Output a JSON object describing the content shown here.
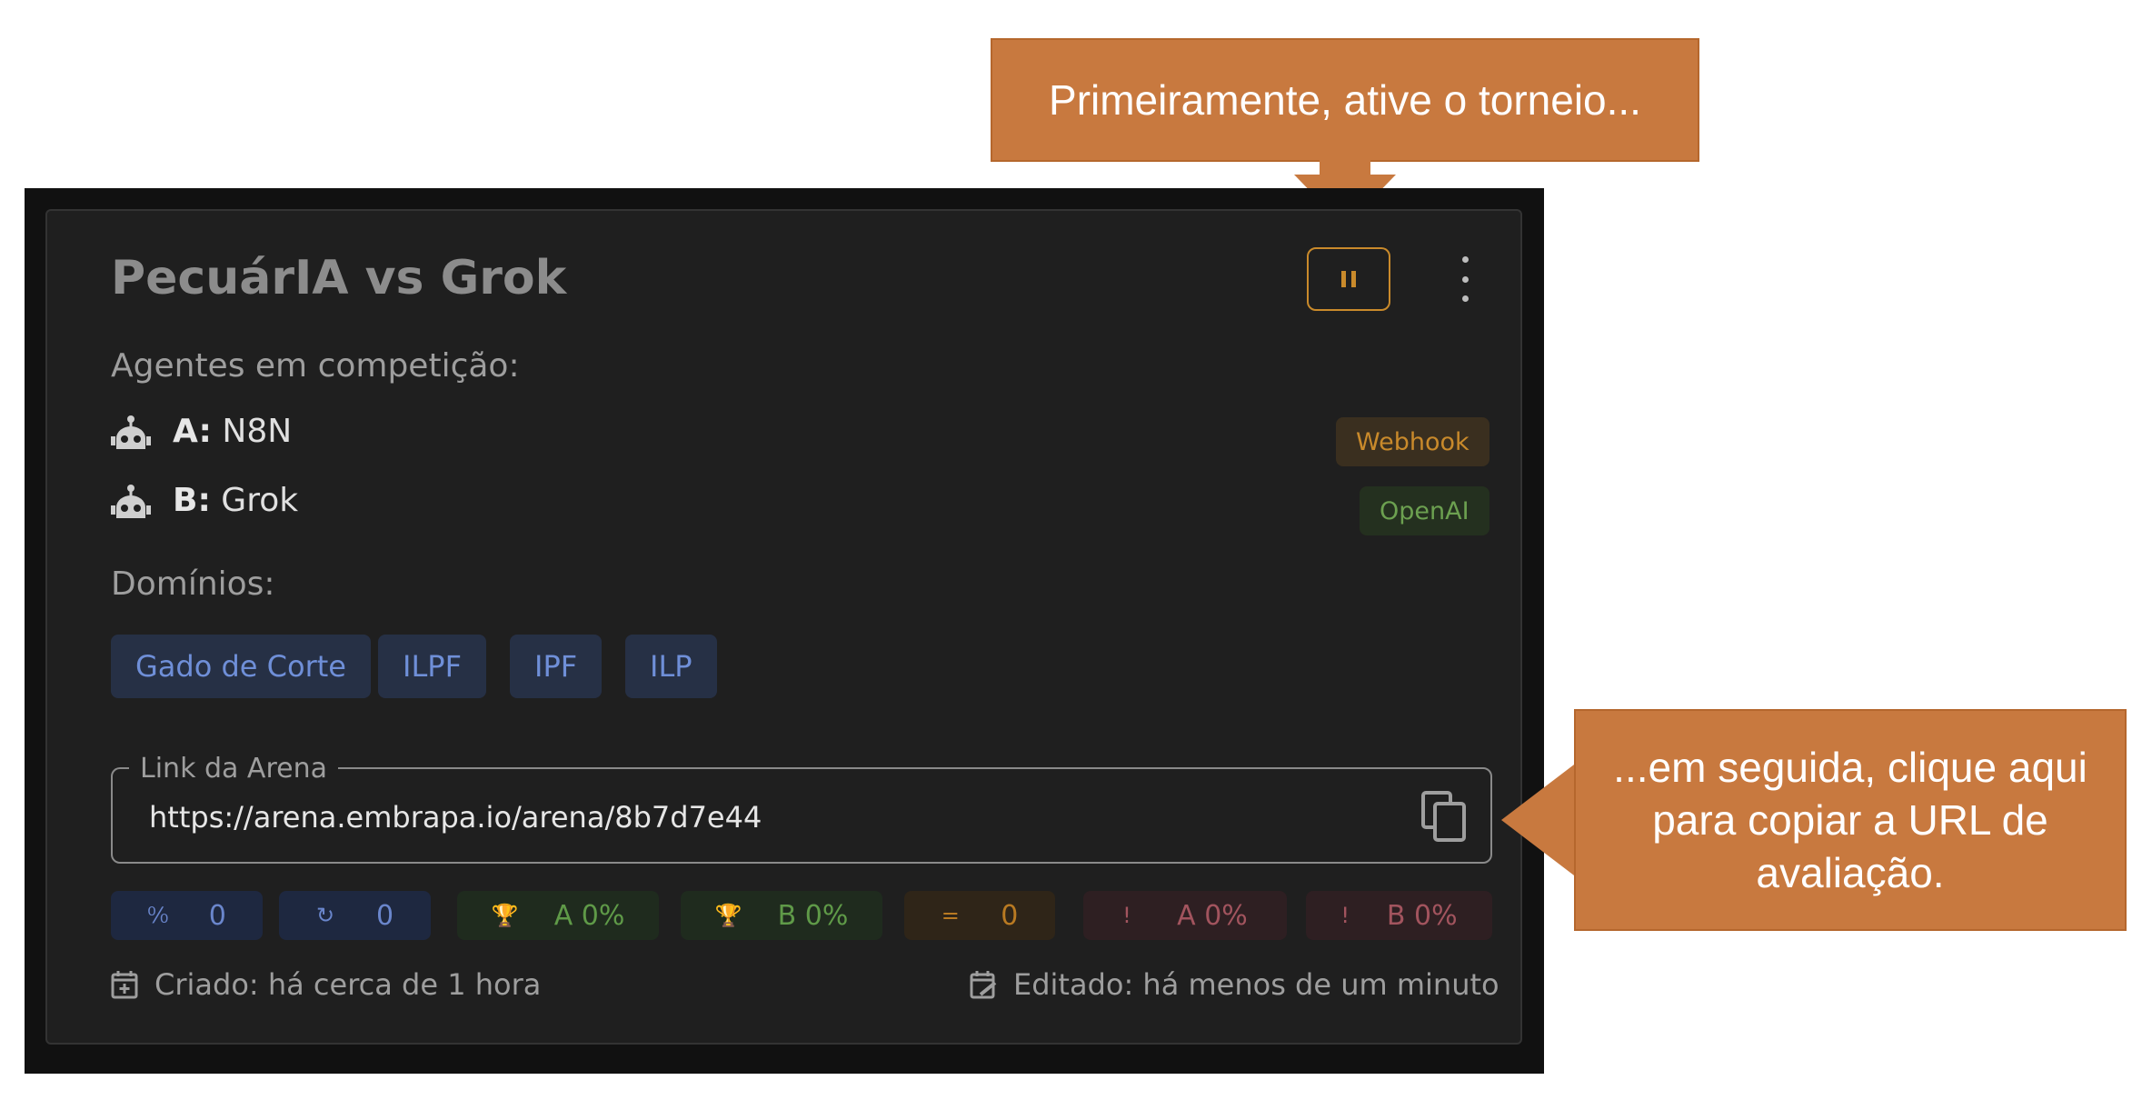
{
  "card": {
    "title": "PecuárIA vs Grok",
    "agents_label": "Agentes em competição:",
    "agents": [
      {
        "prefix": "A:",
        "name": "N8N",
        "source": "Webhook"
      },
      {
        "prefix": "B:",
        "name": "Grok",
        "source": "OpenAI"
      }
    ],
    "domains_label": "Domínios:",
    "domains": [
      "Gado de Corte",
      "ILPF",
      "IPF",
      "ILP"
    ],
    "link_field": {
      "label": "Link da Arena",
      "value": "https://arena.embrapa.io/arena/8b7d7e44"
    },
    "stats": [
      {
        "icon": "percent-icon",
        "glyph": "⁰⁄₀",
        "value": "0"
      },
      {
        "icon": "refresh-icon",
        "glyph": "↻",
        "value": "0"
      },
      {
        "icon": "trophy-icon",
        "glyph": "🏆",
        "value": "A 0%"
      },
      {
        "icon": "trophy-icon",
        "glyph": "🏆",
        "value": "B 0%"
      },
      {
        "icon": "equals-icon",
        "glyph": "=",
        "value": "0"
      },
      {
        "icon": "report-icon",
        "glyph": "!",
        "value": "A 0%"
      },
      {
        "icon": "report-icon",
        "glyph": "!",
        "value": "B 0%"
      }
    ],
    "created": "Criado: há cerca de 1 hora",
    "edited": "Editado: há menos de um minuto"
  },
  "callouts": {
    "first": "Primeiramente, ative o torneio...",
    "second": "...em seguida, clique aqui para copiar a URL de avaliação."
  },
  "colors": {
    "background": "#111111",
    "card": "#1f1f1f",
    "accent_orange": "#c98a2b",
    "callout": "#c8793f",
    "domain_chip": "#263045",
    "domain_text": "#6f8fd8"
  }
}
